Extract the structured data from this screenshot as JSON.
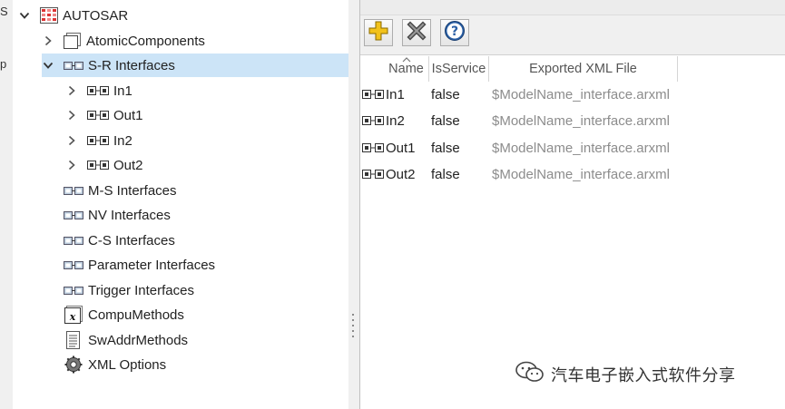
{
  "left_window": {
    "fragments": [
      "S",
      "p"
    ]
  },
  "tree": {
    "root": {
      "label": "AUTOSAR",
      "icon": "autosar-grid-icon"
    },
    "items": [
      {
        "label": "AtomicComponents",
        "icon": "component-icon"
      },
      {
        "label": "S-R Interfaces",
        "icon": "interfaces-icon",
        "selected": true
      },
      {
        "label": "In1",
        "icon": "port-icon"
      },
      {
        "label": "Out1",
        "icon": "port-icon"
      },
      {
        "label": "In2",
        "icon": "port-icon"
      },
      {
        "label": "Out2",
        "icon": "port-icon"
      },
      {
        "label": "M-S Interfaces",
        "icon": "interfaces-icon"
      },
      {
        "label": "NV Interfaces",
        "icon": "interfaces-icon"
      },
      {
        "label": "C-S Interfaces",
        "icon": "interfaces-icon"
      },
      {
        "label": "Parameter Interfaces",
        "icon": "interfaces-icon"
      },
      {
        "label": "Trigger Interfaces",
        "icon": "interfaces-icon"
      },
      {
        "label": "CompuMethods",
        "icon": "compu-icon"
      },
      {
        "label": "SwAddrMethods",
        "icon": "list-icon"
      },
      {
        "label": "XML Options",
        "icon": "gear-icon"
      }
    ]
  },
  "toolbar": {
    "add": "add-icon",
    "delete": "delete-icon",
    "help": "help-icon"
  },
  "table": {
    "columns": [
      "Name",
      "IsService",
      "Exported XML File"
    ],
    "rows": [
      {
        "name": "In1",
        "is_service": "false",
        "xml": "$ModelName_interface.arxml"
      },
      {
        "name": "In2",
        "is_service": "false",
        "xml": "$ModelName_interface.arxml"
      },
      {
        "name": "Out1",
        "is_service": "false",
        "xml": "$ModelName_interface.arxml"
      },
      {
        "name": "Out2",
        "is_service": "false",
        "xml": "$ModelName_interface.arxml"
      }
    ]
  },
  "watermark": {
    "text": "汽车电子嵌入式软件分享"
  },
  "colors": {
    "selection": "#cce4f7",
    "accent": "#1e6fc9"
  }
}
